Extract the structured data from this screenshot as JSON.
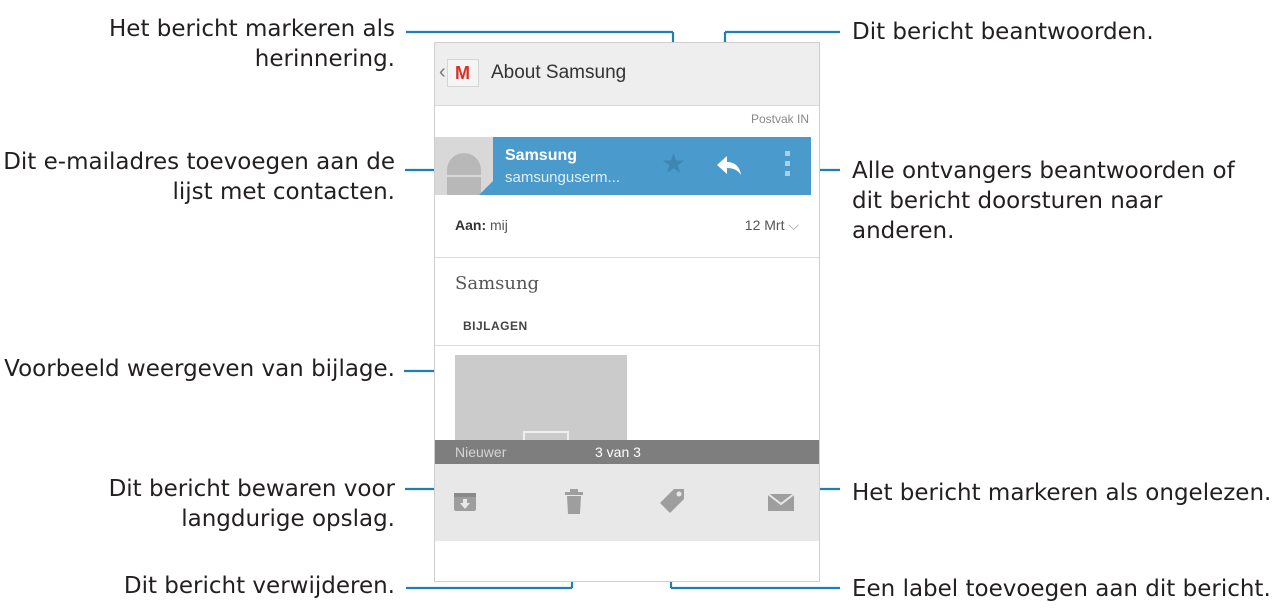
{
  "callouts": {
    "mark_reminder": "Het bericht markeren als\nherinnering.",
    "add_contact": "Dit e-mailadres toevoegen aan de\nlijst met contacten.",
    "preview_attachment": "Voorbeeld weergeven van bijlage.",
    "archive": "Dit bericht bewaren voor\nlangdurige opslag.",
    "delete": "Dit bericht verwijderen.",
    "reply": "Dit bericht beantwoorden.",
    "reply_all_forward": "Alle ontvangers beantwoorden of\ndit bericht doorsturen naar\nanderen.",
    "mark_unread": "Het bericht markeren als ongelezen.",
    "add_label": "Een label toevoegen aan dit bericht."
  },
  "appbar": {
    "title": "About Samsung",
    "logo_letter": "M"
  },
  "folder": "Postvak IN",
  "sender": {
    "name": "Samsung",
    "address": "samsunguserm..."
  },
  "recipient": {
    "label": "Aan:",
    "value": "mij",
    "date": "12 Mrt"
  },
  "message": {
    "subject": "Samsung",
    "attachments_label": "BIJLAGEN"
  },
  "navbar": {
    "newer": "Nieuwer",
    "position": "3 van 3"
  },
  "icons": [
    "back-icon",
    "gmail-logo-icon",
    "star-icon",
    "reply-icon",
    "overflow-menu-icon",
    "chevron-down-icon",
    "archive-icon",
    "trash-icon",
    "label-icon",
    "mail-unread-icon"
  ],
  "colors": {
    "accent": "#4a9bcb",
    "callout_line": "#1e7fb5"
  }
}
